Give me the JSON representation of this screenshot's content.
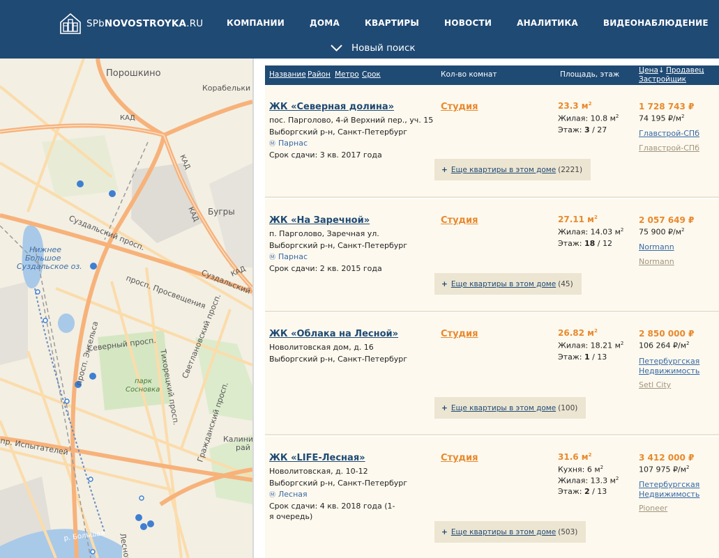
{
  "header": {
    "logo_prefix": "SPb",
    "logo_bold": "NOVOSTROYKA",
    "logo_suffix": ".RU",
    "nav": [
      "КОМПАНИИ",
      "ДОМА",
      "КВАРТИРЫ",
      "НОВОСТИ",
      "АНАЛИТИКА",
      "ВИДЕОНАБЛЮДЕНИЕ"
    ],
    "new_search": "Новый поиск"
  },
  "map": {
    "labels": {
      "poroshkino": "Порошкино",
      "korabelsky": "Корабельки",
      "kad1": "КАД",
      "kad2": "КАД",
      "kad3": "КАД",
      "bugry": "Бугры",
      "suzdalsky1": "Суздальский просп.",
      "suzdalsky2": "Суздальский просп.",
      "lake1": "Нижнее",
      "lake2": "Большое",
      "lake3": "Суздальское оз.",
      "prosveshcheniya": "просп. Просвещения",
      "engelsa": "просп. Энгельса",
      "severny": "Северный просп.",
      "tikhoretsky": "Тихорецкий просп.",
      "svetlanovsky": "Светлановский просп.",
      "park1": "парк",
      "park2": "Сосновка",
      "grazhdansky": "Гражданский просп.",
      "kalinin1": "Калини",
      "kalinin2": "рай",
      "ispytateley": "пр. Испытателей",
      "bolshaya": "р. Большая",
      "lesnoy": "Лесной"
    },
    "colors": {
      "land": "#f3efe3",
      "major_road": "#f7b27a",
      "road": "#fbdcab",
      "water": "#a9c9e8",
      "park": "#d5e7c2",
      "industrial": "#dfdcd6",
      "marker": "#3f7fd1"
    }
  },
  "table": {
    "headers": {
      "name": "Название",
      "district": "Район",
      "metro": "Метро",
      "term": "Срок",
      "rooms": "Кол-во комнат",
      "area": "Площадь, этаж",
      "price": "Цена",
      "price_sort_mark": "↓",
      "seller": "Продавец",
      "builder": "Застройщик"
    },
    "rows": [
      {
        "name": "ЖК «Северная долина»",
        "address": "пос. Парголово, 4-й Верхний пер., уч. 15",
        "district": "Выборгский р-н, Санкт-Петербург",
        "metro": "Парнас",
        "term": "Срок сдачи: 3 кв. 2017 года",
        "rooms": "Студия",
        "area": "23.3 м",
        "area_sup": "2",
        "living": "Жилая: 10.8 м",
        "living_sup": "2",
        "floor_label": "Этаж: ",
        "floor": "3",
        "floors_total": " / 27",
        "price": "1 728 743 ₽",
        "price_per_m": "74 195 ₽/м",
        "price_per_m_sup": "2",
        "seller": "Главстрой-СПб",
        "builder": "Главстрой-СПб",
        "more_link": "Еще квартиры в этом доме",
        "more_count": "(2221)"
      },
      {
        "name": "ЖК «На Заречной»",
        "address": "п. Парголово, Заречная ул.",
        "district": "Выборгский р-н, Санкт-Петербург",
        "metro": "Парнас",
        "term": "Срок сдачи: 2 кв. 2015 года",
        "rooms": "Студия",
        "area": "27.11 м",
        "area_sup": "2",
        "living": "Жилая: 14.03 м",
        "living_sup": "2",
        "floor_label": "Этаж: ",
        "floor": "18",
        "floors_total": " / 12",
        "price": "2 057 649 ₽",
        "price_per_m": "75 900 ₽/м",
        "price_per_m_sup": "2",
        "seller": "Normann",
        "builder": "Normann",
        "more_link": "Еще квартиры в этом доме",
        "more_count": "(45)"
      },
      {
        "name": "ЖК «Облака на Лесной»",
        "address": "Новолитовская дом, д. 16",
        "district": "Выборгский р-н, Санкт-Петербург",
        "rooms": "Студия",
        "area": "26.82 м",
        "area_sup": "2",
        "living": "Жилая: 18.21 м",
        "living_sup": "2",
        "floor_label": "Этаж: ",
        "floor": "1",
        "floors_total": " / 13",
        "price": "2 850 000 ₽",
        "price_per_m": "106 264 ₽/м",
        "price_per_m_sup": "2",
        "seller_line1": "Петербургская",
        "seller_line2": "Недвижимость",
        "builder": "Setl City",
        "more_link": "Еще квартиры в этом доме",
        "more_count": "(100)"
      },
      {
        "name": "ЖК «LIFE-Лесная»",
        "address": "Новолитовская, д. 10-12",
        "district": "Выборгский р-н, Санкт-Петербург",
        "metro": "Лесная",
        "term_line1": "Срок сдачи: 4 кв. 2018 года (1-",
        "term_line2": "я очередь)",
        "rooms": "Студия",
        "area": "31.6 м",
        "area_sup": "2",
        "kitchen": "Кухня: 6 м",
        "kitchen_sup": "2",
        "living": "Жилая: 13.3 м",
        "living_sup": "2",
        "floor_label": "Этаж: ",
        "floor": "2",
        "floors_total": " / 13",
        "price": "3 412 000 ₽",
        "price_per_m": "107 975 ₽/м",
        "price_per_m_sup": "2",
        "seller_line1": "Петербургская",
        "seller_line2": "Недвижимость",
        "builder": "Pioneer",
        "more_link": "Еще квартиры в этом доме",
        "more_count": "(503)"
      }
    ]
  },
  "icons": {
    "metro": "Ⓜ",
    "plus": "+"
  }
}
